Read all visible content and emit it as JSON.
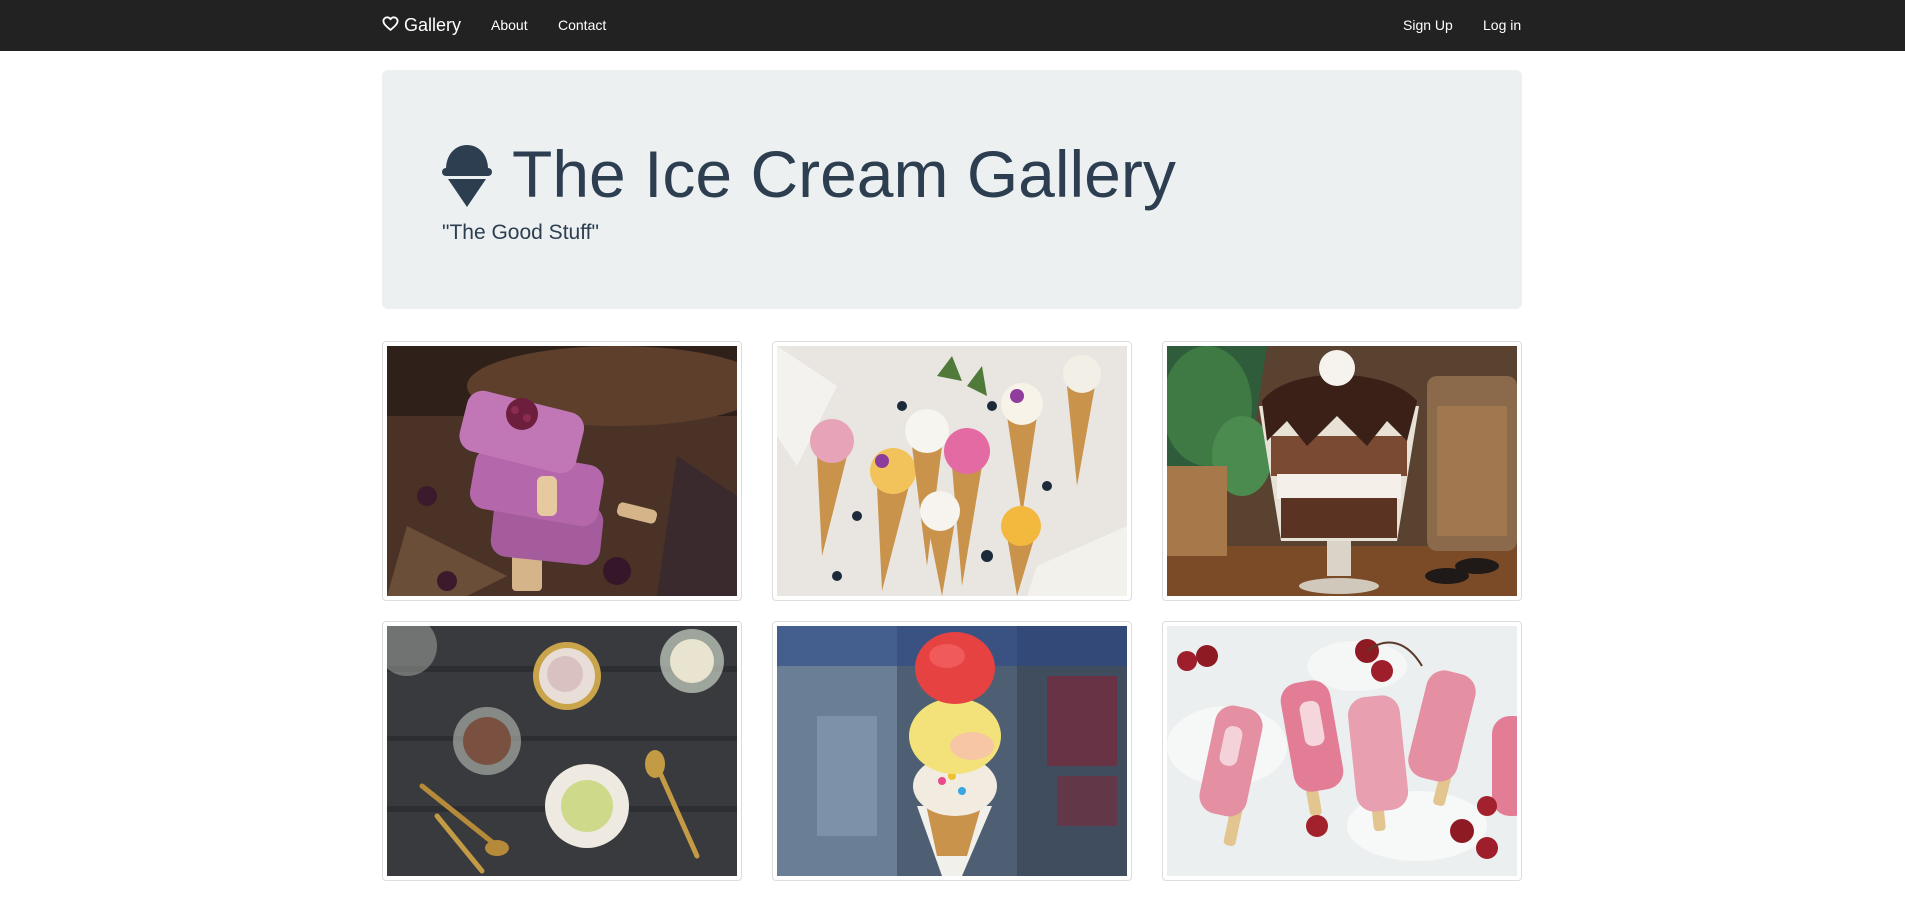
{
  "navbar": {
    "brand_label": "Gallery",
    "brand_icon": "heart-icon",
    "left_links": [
      "About",
      "Contact"
    ],
    "right_links": [
      "Sign Up",
      "Log in"
    ],
    "background": "#222222",
    "text_color": "#ffffff"
  },
  "jumbotron": {
    "title": "The Ice Cream Gallery",
    "title_icon": "ice-cream-icon",
    "subtitle": "\"The Good Stuff\"",
    "background": "#ecf0f1",
    "text_color": "#2c3e50"
  },
  "gallery": {
    "photos": [
      {
        "subject": "berry-popsicles-photo"
      },
      {
        "subject": "ice-cream-cones-photo"
      },
      {
        "subject": "chocolate-sundae-photo"
      },
      {
        "subject": "ice-cream-bowls-photo"
      },
      {
        "subject": "rainbow-cone-photo"
      },
      {
        "subject": "cherry-popsicles-photo"
      }
    ]
  }
}
